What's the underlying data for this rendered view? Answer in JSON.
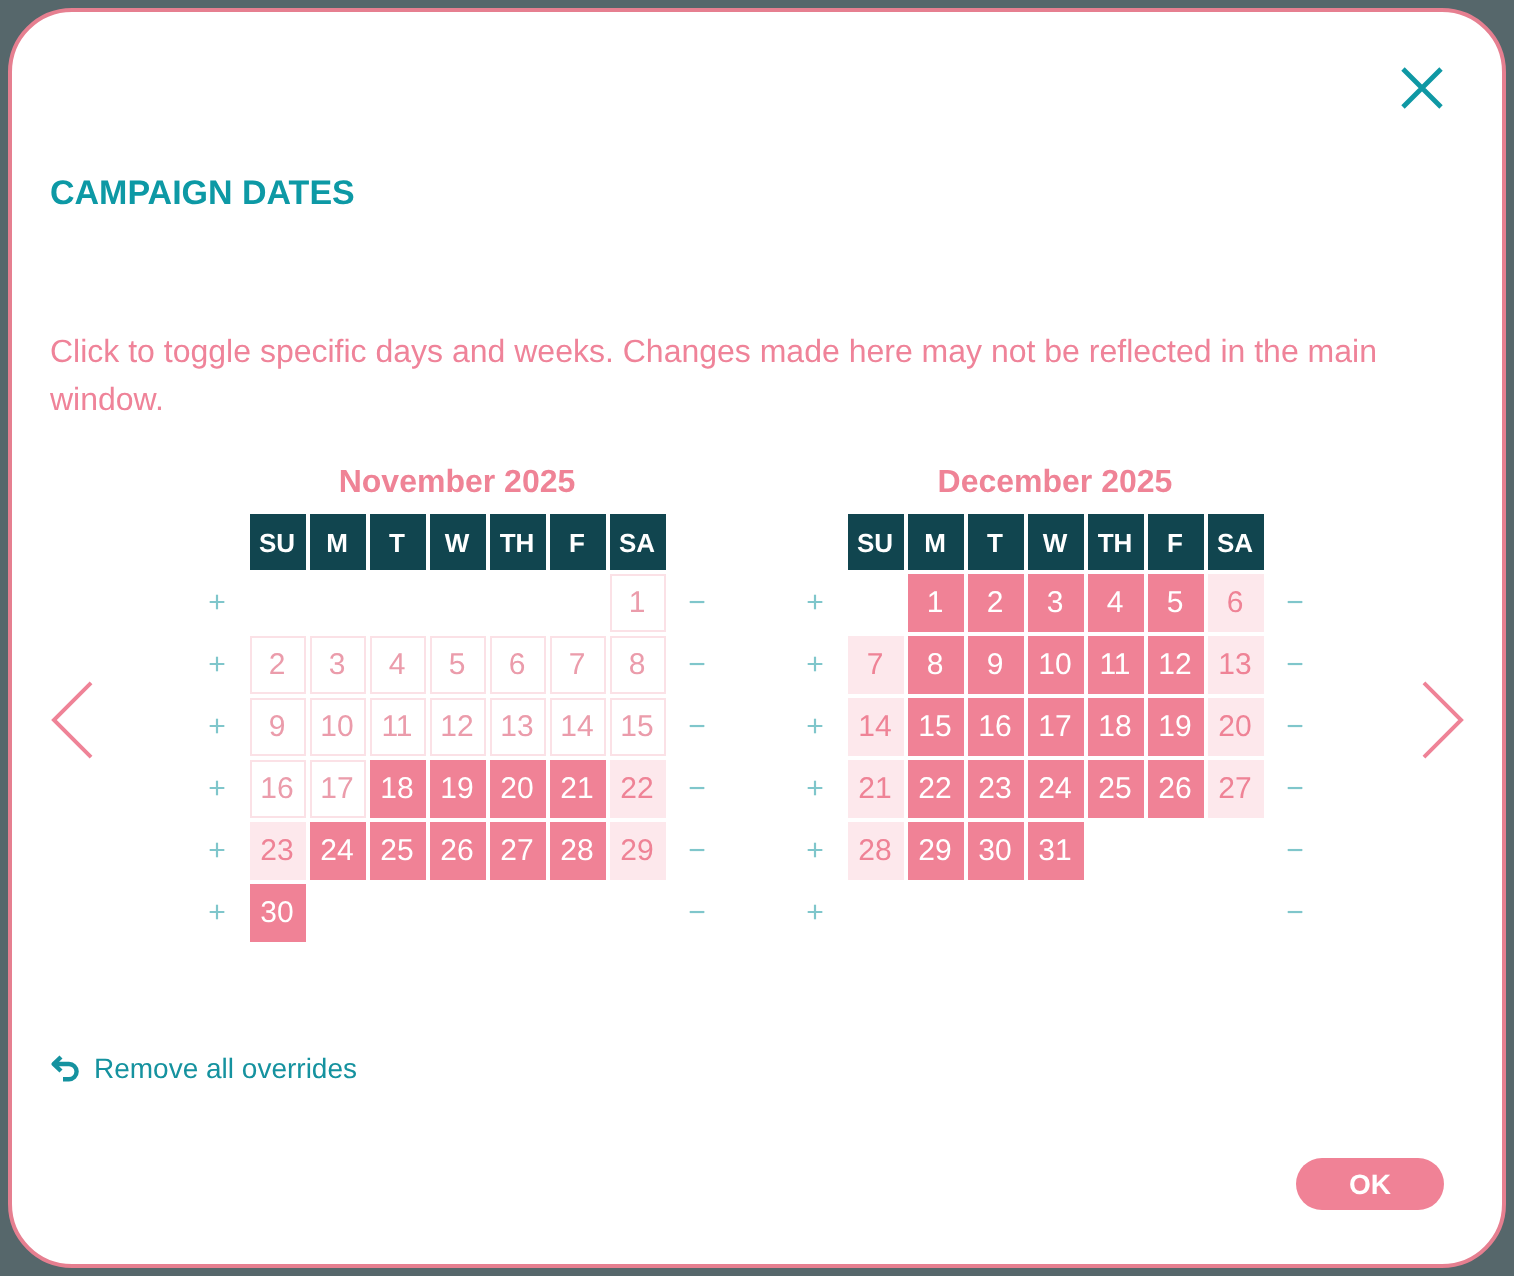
{
  "dialog": {
    "title": "CAMPAIGN DATES",
    "description": "Click to toggle specific days and weeks. Changes made here may not be reflected in the main window."
  },
  "months": [
    {
      "title": "November 2025",
      "weekdays": [
        "SU",
        "M",
        "T",
        "W",
        "TH",
        "F",
        "SA"
      ],
      "weeks": [
        {
          "add": "+",
          "remove": "−",
          "days": [
            {
              "label": "1",
              "selected": false,
              "disabled": true
            }
          ]
        },
        {
          "add": "+",
          "remove": "−",
          "days": [
            {
              "label": "2",
              "selected": false,
              "disabled": true
            },
            {
              "label": "3",
              "selected": false,
              "disabled": true
            },
            {
              "label": "4",
              "selected": false,
              "disabled": true
            },
            {
              "label": "5",
              "selected": false,
              "disabled": true
            },
            {
              "label": "6",
              "selected": false,
              "disabled": true
            },
            {
              "label": "7",
              "selected": false,
              "disabled": true
            },
            {
              "label": "8",
              "selected": false,
              "disabled": true
            }
          ]
        },
        {
          "add": "+",
          "remove": "−",
          "days": [
            {
              "label": "9",
              "selected": false,
              "disabled": true
            },
            {
              "label": "10",
              "selected": false,
              "disabled": true
            },
            {
              "label": "11",
              "selected": false,
              "disabled": true
            },
            {
              "label": "12",
              "selected": false,
              "disabled": true
            },
            {
              "label": "13",
              "selected": false,
              "disabled": true
            },
            {
              "label": "14",
              "selected": false,
              "disabled": true
            },
            {
              "label": "15",
              "selected": false,
              "disabled": true
            }
          ]
        },
        {
          "add": "+",
          "remove": "−",
          "days": [
            {
              "label": "16",
              "selected": false,
              "disabled": true
            },
            {
              "label": "17",
              "selected": false,
              "disabled": true
            },
            {
              "label": "18",
              "selected": true,
              "disabled": false
            },
            {
              "label": "19",
              "selected": true,
              "disabled": false
            },
            {
              "label": "20",
              "selected": true,
              "disabled": false
            },
            {
              "label": "21",
              "selected": true,
              "disabled": false
            },
            {
              "label": "22",
              "selected": false,
              "disabled": false
            }
          ]
        },
        {
          "add": "+",
          "remove": "−",
          "days": [
            {
              "label": "23",
              "selected": false,
              "disabled": false
            },
            {
              "label": "24",
              "selected": true,
              "disabled": false
            },
            {
              "label": "25",
              "selected": true,
              "disabled": false
            },
            {
              "label": "26",
              "selected": true,
              "disabled": false
            },
            {
              "label": "27",
              "selected": true,
              "disabled": false
            },
            {
              "label": "28",
              "selected": true,
              "disabled": false
            },
            {
              "label": "29",
              "selected": false,
              "disabled": false
            }
          ]
        },
        {
          "add": "+",
          "remove": "−",
          "days": [
            {
              "label": "30",
              "selected": true,
              "disabled": false
            }
          ]
        }
      ]
    },
    {
      "title": "December 2025",
      "weekdays": [
        "SU",
        "M",
        "T",
        "W",
        "TH",
        "F",
        "SA"
      ],
      "weeks": [
        {
          "add": "+",
          "remove": "−",
          "days": [
            {
              "label": "1",
              "selected": true,
              "disabled": false
            },
            {
              "label": "2",
              "selected": true,
              "disabled": false
            },
            {
              "label": "3",
              "selected": true,
              "disabled": false
            },
            {
              "label": "4",
              "selected": true,
              "disabled": false
            },
            {
              "label": "5",
              "selected": true,
              "disabled": false
            },
            {
              "label": "6",
              "selected": false,
              "disabled": false
            }
          ]
        },
        {
          "add": "+",
          "remove": "−",
          "days": [
            {
              "label": "7",
              "selected": false,
              "disabled": false
            },
            {
              "label": "8",
              "selected": true,
              "disabled": false
            },
            {
              "label": "9",
              "selected": true,
              "disabled": false
            },
            {
              "label": "10",
              "selected": true,
              "disabled": false
            },
            {
              "label": "11",
              "selected": true,
              "disabled": false
            },
            {
              "label": "12",
              "selected": true,
              "disabled": false
            },
            {
              "label": "13",
              "selected": false,
              "disabled": false
            }
          ]
        },
        {
          "add": "+",
          "remove": "−",
          "days": [
            {
              "label": "14",
              "selected": false,
              "disabled": false
            },
            {
              "label": "15",
              "selected": true,
              "disabled": false
            },
            {
              "label": "16",
              "selected": true,
              "disabled": false
            },
            {
              "label": "17",
              "selected": true,
              "disabled": false
            },
            {
              "label": "18",
              "selected": true,
              "disabled": false
            },
            {
              "label": "19",
              "selected": true,
              "disabled": false
            },
            {
              "label": "20",
              "selected": false,
              "disabled": false
            }
          ]
        },
        {
          "add": "+",
          "remove": "−",
          "days": [
            {
              "label": "21",
              "selected": false,
              "disabled": false
            },
            {
              "label": "22",
              "selected": true,
              "disabled": false
            },
            {
              "label": "23",
              "selected": true,
              "disabled": false
            },
            {
              "label": "24",
              "selected": true,
              "disabled": false
            },
            {
              "label": "25",
              "selected": true,
              "disabled": false
            },
            {
              "label": "26",
              "selected": true,
              "disabled": false
            },
            {
              "label": "27",
              "selected": false,
              "disabled": false
            }
          ]
        },
        {
          "add": "+",
          "remove": "−",
          "days": [
            {
              "label": "28",
              "selected": false,
              "disabled": false
            },
            {
              "label": "29",
              "selected": true,
              "disabled": false
            },
            {
              "label": "30",
              "selected": true,
              "disabled": false
            },
            {
              "label": "31",
              "selected": true,
              "disabled": false
            }
          ]
        },
        {
          "add": "+",
          "remove": "−"
        }
      ]
    }
  ],
  "remove_overrides": {
    "label": "Remove all overrides"
  },
  "ok_button": {
    "label": "OK"
  }
}
